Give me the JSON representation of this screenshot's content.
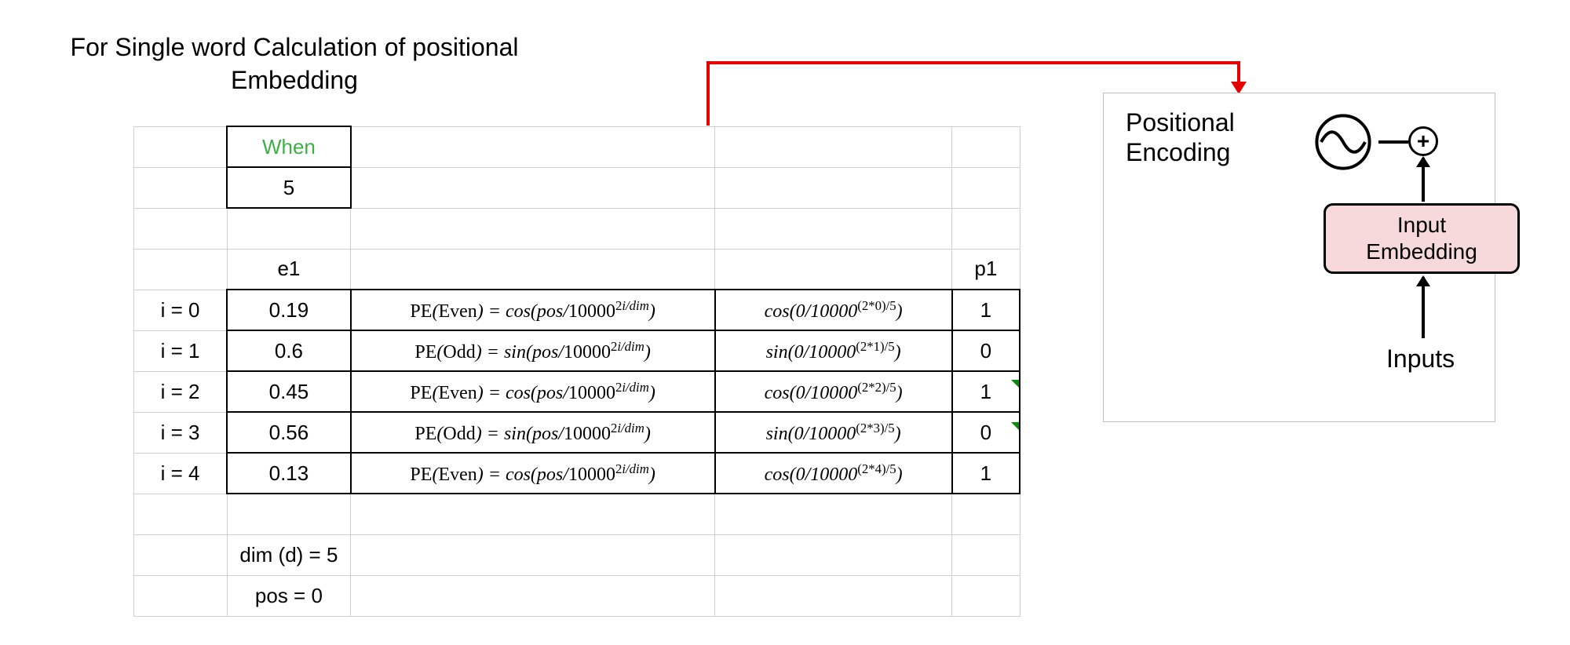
{
  "title_line1": "For Single word Calculation of positional",
  "title_line2": "Embedding",
  "table": {
    "word": "When",
    "word_dim": "5",
    "e_label": "e1",
    "p_label": "p1",
    "rows": [
      {
        "i": "i = 0",
        "e": "0.19",
        "pe_type": "even",
        "sub_i": "0",
        "p": "1"
      },
      {
        "i": "i = 1",
        "e": "0.6",
        "pe_type": "odd",
        "sub_i": "1",
        "p": "0"
      },
      {
        "i": "i = 2",
        "e": "0.45",
        "pe_type": "even",
        "sub_i": "2",
        "p": "1"
      },
      {
        "i": "i = 3",
        "e": "0.56",
        "pe_type": "odd",
        "sub_i": "3",
        "p": "0"
      },
      {
        "i": "i = 4",
        "e": "0.13",
        "pe_type": "even",
        "sub_i": "4",
        "p": "1"
      }
    ],
    "footer1": "dim (d) = 5",
    "footer2": "pos = 0"
  },
  "pe_formula_even_html": "<span class='rm'>PE</span>(<span class='rm'>Even</span>) = cos(pos/<span class='rm'>10000</span><sup><span class='rm'>2</span>i/dim</sup>)",
  "pe_formula_odd_html": "<span class='rm'>PE</span>(<span class='rm'>Odd</span>) = sin(pos/<span class='rm'>10000</span><sup><span class='rm'>2</span>i/dim</sup>)",
  "sub_prefix_cos": "cos(0/10000",
  "sub_prefix_sin": "sin(0/10000",
  "sub_suffix": ")",
  "panel": {
    "pe_line1": "Positional",
    "pe_line2": "Encoding",
    "embed_line1": "Input",
    "embed_line2": "Embedding",
    "inputs": "Inputs"
  }
}
